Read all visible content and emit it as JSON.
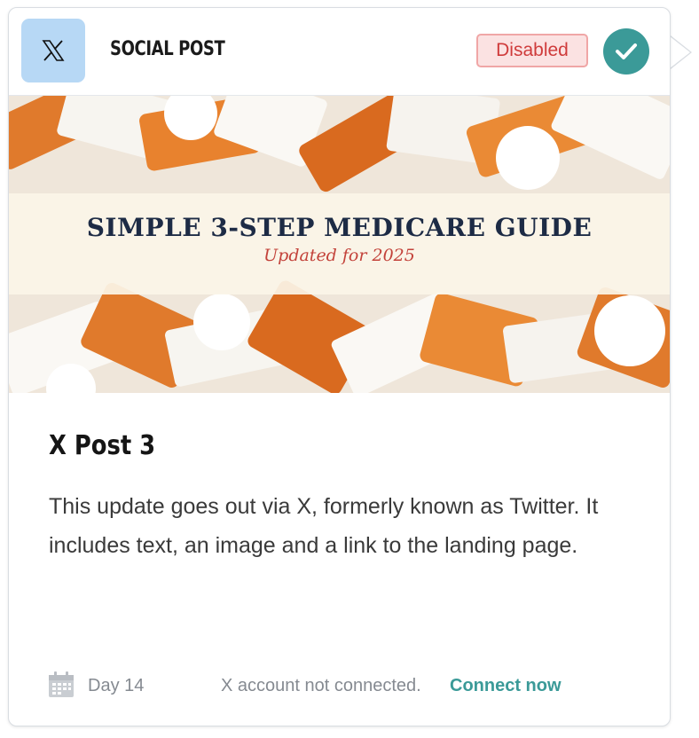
{
  "header": {
    "app_icon": "x-logo-icon",
    "card_type": "SOCIAL POST",
    "status_badge": "Disabled",
    "status_check_icon": "checkmark-icon",
    "colors": {
      "badge_text": "#cf3b3b",
      "badge_bg": "#fbe2e2",
      "check_bg": "#3b9a98",
      "icon_bg": "#b7d8f5"
    }
  },
  "hero": {
    "title": "SIMPLE 3-STEP MEDICARE GUIDE",
    "subtitle": "Updated for 2025"
  },
  "post": {
    "title": "X Post 3",
    "description": "This update goes out via X, formerly known as Twitter. It includes text, an image and a link to the landing page."
  },
  "footer": {
    "calendar_icon": "calendar-icon",
    "day": "Day 14",
    "account_status": "X account not connected.",
    "connect_link": "Connect now"
  }
}
